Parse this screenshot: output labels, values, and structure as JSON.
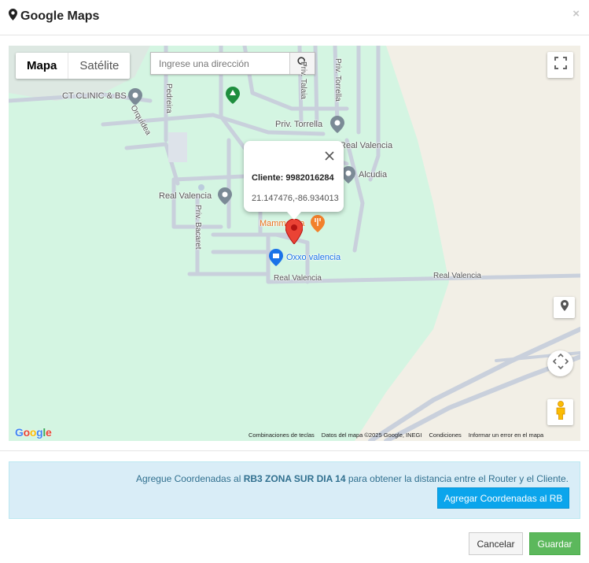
{
  "header": {
    "title": "Google Maps",
    "close_label": "×"
  },
  "map": {
    "map_type_tabs": [
      "Mapa",
      "Satélite"
    ],
    "search_placeholder": "Ingrese una dirección",
    "info_window": {
      "client_label": "Cliente: 9982016284",
      "coordinates": "21.147476,-86.934013"
    },
    "places": {
      "ct_clinic": "CT CLINIC & BS",
      "orquidea": "Orquídea",
      "pedreira": "Pedreira",
      "priv_talaia": "Priv. Talaia",
      "priv_torrella_v": "Priv. Torrella",
      "priv_torrella": "Priv. Torrella",
      "real_valencia_1": "Real Valencia",
      "alcudia": "Alcudia",
      "real_valencia_2": "Real Valencia",
      "priv_bacaret": "Priv. Bacaret",
      "mammamia": "Mammamia",
      "oxxo": "Oxxo valencia",
      "real_valencia_road1": "Real Valencia",
      "real_valencia_road2": "Real Valencia"
    },
    "logo": "Google",
    "attribution": [
      "Combinaciones de teclas",
      "Datos del mapa ©2025 Google, INEGI",
      "Condiciones",
      "Informar un error en el mapa"
    ]
  },
  "alert": {
    "text_before": "Agregue Coordenadas al ",
    "router_name": "RB3 ZONA SUR DIA 14",
    "text_after": " para obtener la distancia entre el Router y el Cliente.",
    "button_label": "Agregar Coordenadas al RB"
  },
  "footer": {
    "cancel_label": "Cancelar",
    "save_label": "Guardar"
  },
  "colors": {
    "map_park": "#d4f5e2",
    "map_sand": "#f2efe6",
    "road": "#c9d0dc",
    "alert_bg": "#d9edf7",
    "alert_text": "#31708f",
    "primary_button": "#0ba5ec",
    "save_button": "#5cb85c",
    "marker": "#ea4335"
  }
}
